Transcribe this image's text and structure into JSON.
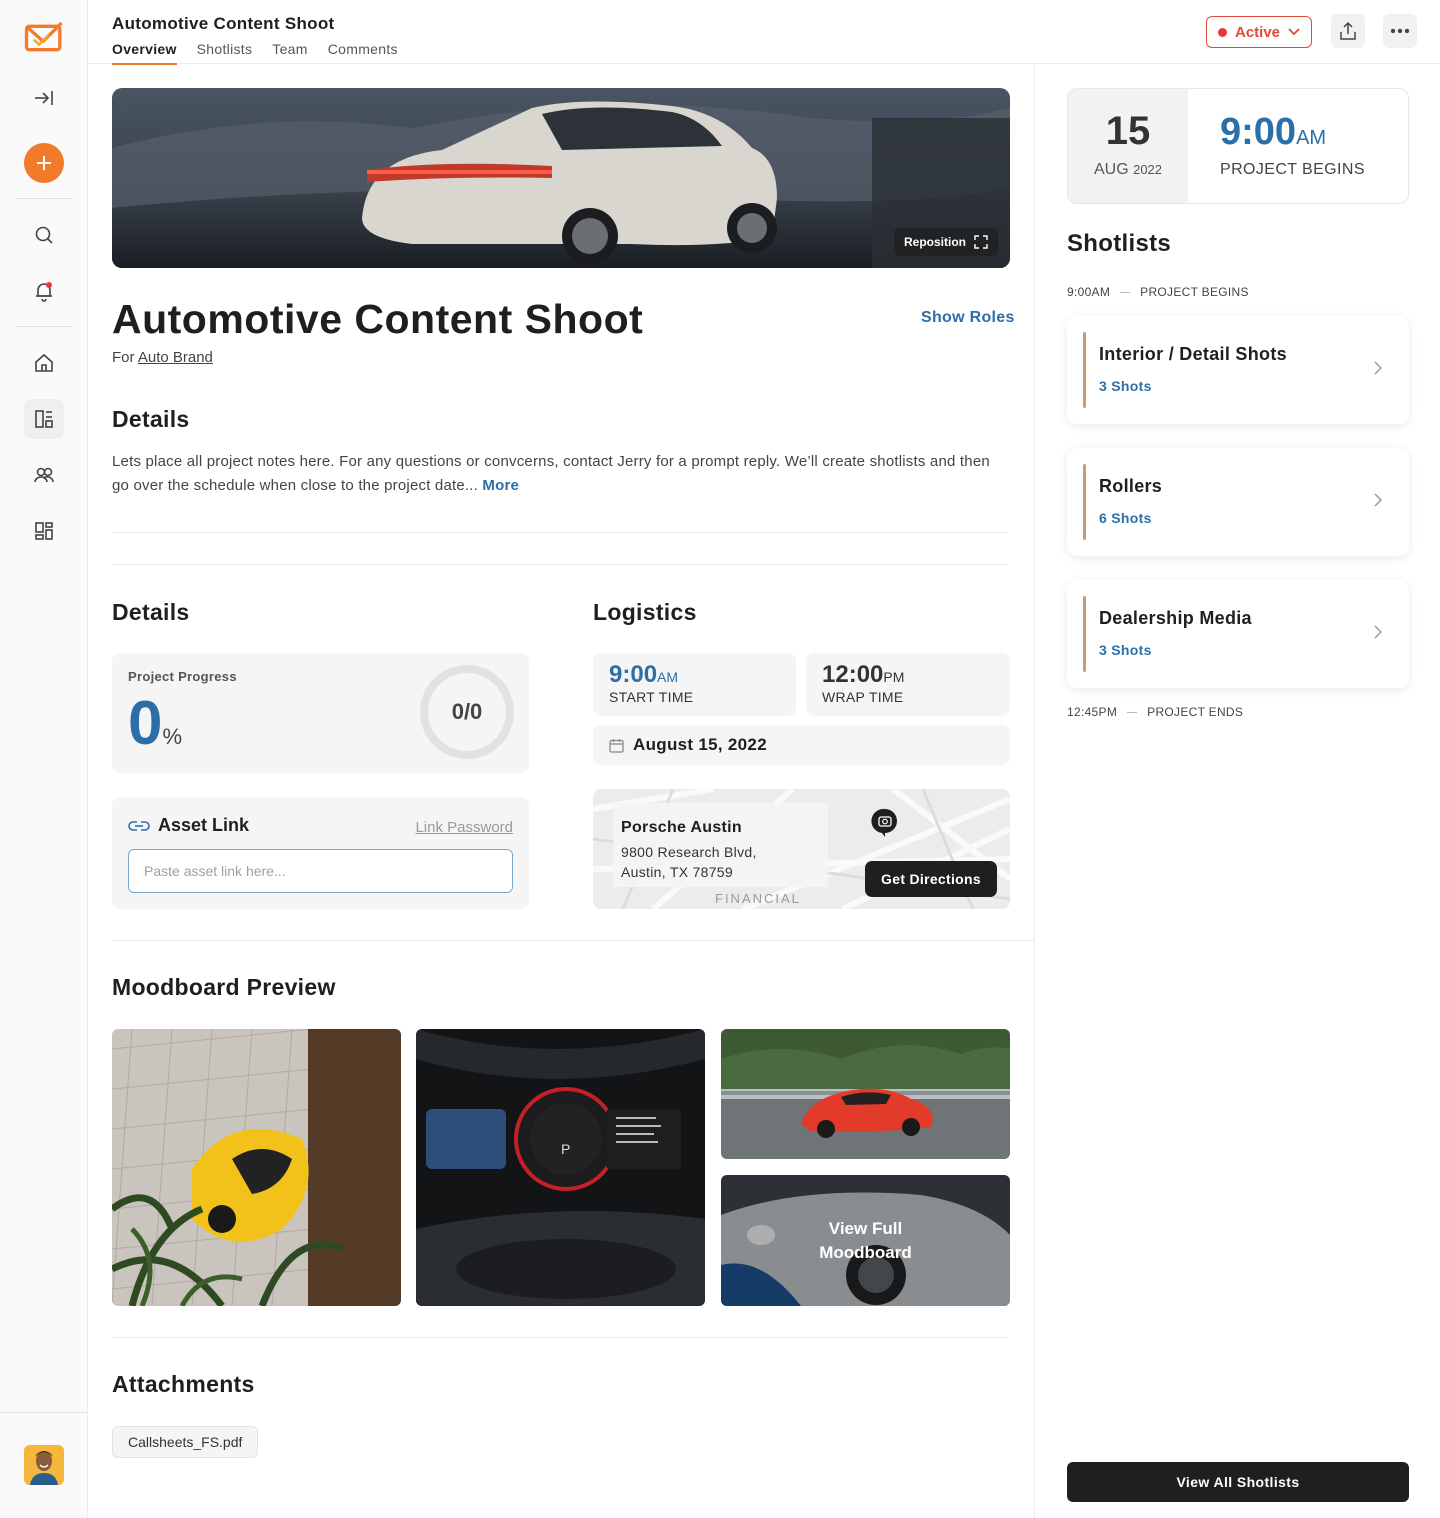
{
  "header": {
    "title": "Automotive Content Shoot",
    "tabs": [
      {
        "label": "Overview"
      },
      {
        "label": "Shotlists"
      },
      {
        "label": "Team"
      },
      {
        "label": "Comments"
      }
    ],
    "status_label": "Active"
  },
  "hero": {
    "reposition_label": "Reposition"
  },
  "project": {
    "title": "Automotive Content Shoot",
    "client_prefix": "For",
    "client_name": "Auto Brand",
    "show_roles_label": "Show Roles"
  },
  "notes": {
    "heading": "Details",
    "text": "Lets place all project notes here. For any questions or convcerns, contact Jerry for a prompt reply. We’ll create shotlists and then go over the schedule when close to the project date...",
    "more_label": "More"
  },
  "details": {
    "heading": "Details",
    "progress_label": "Project Progress",
    "progress_value": "0",
    "progress_unit": "%",
    "progress_ring": "0/0",
    "asset_link_label": "Asset Link",
    "link_password_label": "Link Password",
    "asset_placeholder": "Paste asset link here..."
  },
  "logistics": {
    "heading": "Logistics",
    "start_time": "9:00",
    "start_ampm": "AM",
    "start_label": "START TIME",
    "wrap_time": "12:00",
    "wrap_ampm": "PM",
    "wrap_label": "WRAP TIME",
    "date": "August 15, 2022",
    "location_name": "Porsche Austin",
    "address_line1": "9800 Research Blvd,",
    "address_line2": "Austin, TX 78759",
    "map_label": "FINANCIAL",
    "directions_label": "Get Directions"
  },
  "moodboard": {
    "heading": "Moodboard Preview",
    "view_full_line1": "View Full",
    "view_full_line2": "Moodboard"
  },
  "attachments": {
    "heading": "Attachments",
    "files": [
      "Callsheets_FS.pdf"
    ]
  },
  "schedule": {
    "day": "15",
    "month": "AUG",
    "year": "2022",
    "time": "9:00",
    "ampm": "AM",
    "label": "PROJECT BEGINS"
  },
  "shotlists": {
    "heading": "Shotlists",
    "start_time": "9:00AM",
    "start_label": "PROJECT BEGINS",
    "end_time": "12:45PM",
    "end_label": "PROJECT ENDS",
    "items": [
      {
        "name": "Interior / Detail Shots",
        "count": "3 Shots"
      },
      {
        "name": "Rollers",
        "count": "6 Shots"
      },
      {
        "name": "Dealership Media",
        "count": "3 Shots"
      }
    ],
    "view_all_label": "View All Shotlists"
  },
  "colors": {
    "accent": "#f27b2b",
    "link_blue": "#2c6fa8",
    "status_red": "#e04a3a",
    "dark": "#1f1f1f"
  },
  "icons": {
    "sidebar": [
      "logo-icon",
      "collapse-icon",
      "add-icon",
      "search-icon",
      "bell-icon",
      "home-icon",
      "dashboard-icon",
      "team-icon",
      "grid-icon"
    ]
  }
}
